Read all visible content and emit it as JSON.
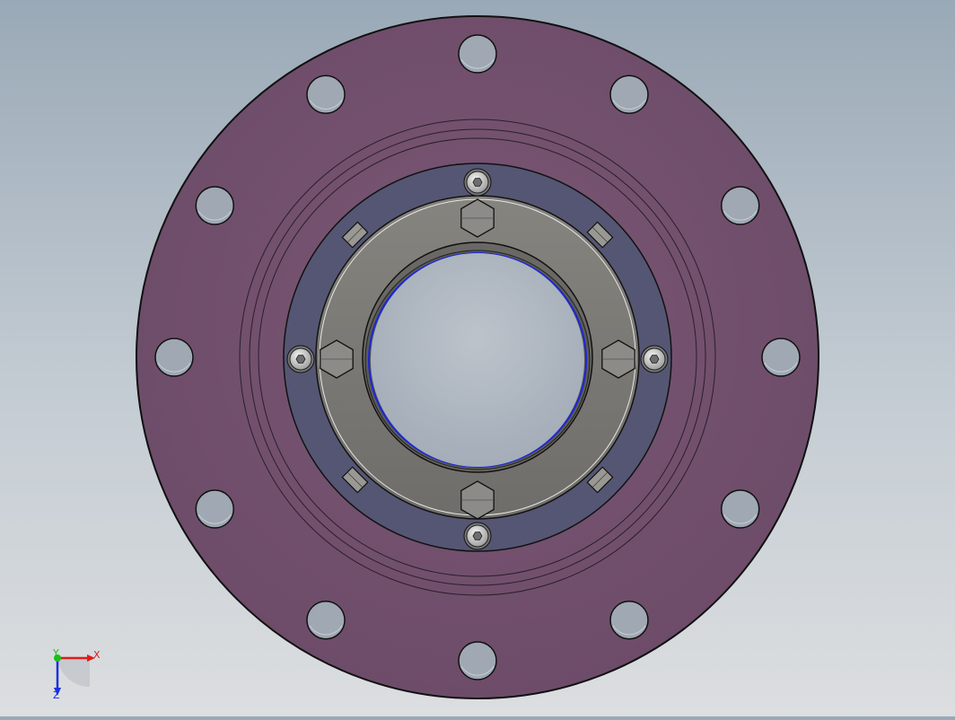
{
  "viewport": {
    "background_top": "#9aa9b7",
    "background_bottom": "#dcdee0"
  },
  "model": {
    "flange_color": "#74526e",
    "retainer_ring_color": "#555673",
    "gland_plate_color": "#7d7b77",
    "hex_bolt_color": "#8d8b88",
    "socket_screw_color": "#c9c9c9",
    "seal_edge_color": "#1a27d6",
    "outline_color": "#111111",
    "bolt_hole_count": 12,
    "hex_bolt_count": 4,
    "socket_screw_count": 4,
    "set_screw_count": 4
  },
  "triad": {
    "x_label": "X",
    "y_label": "Y",
    "z_label": "Z",
    "x_color": "#e11b1b",
    "y_color": "#1bbf1b",
    "z_color": "#1b2fe1"
  }
}
